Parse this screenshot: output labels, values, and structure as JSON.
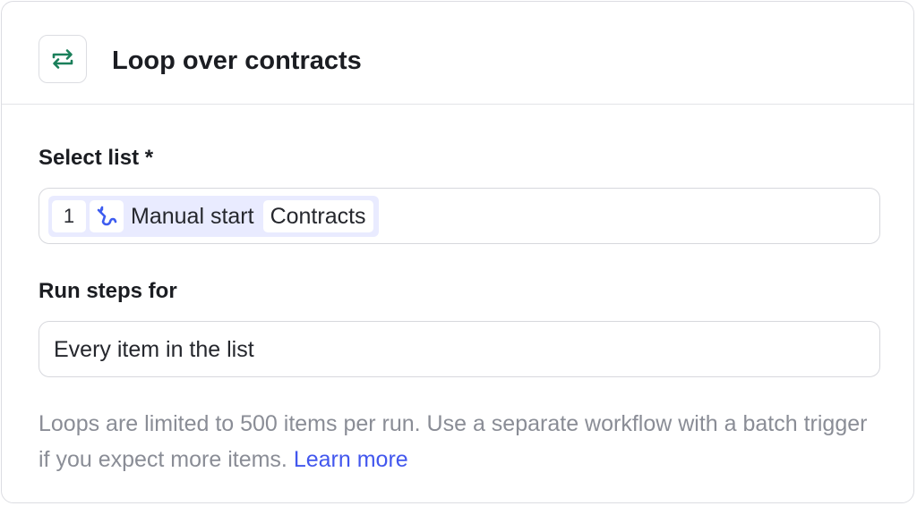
{
  "header": {
    "icon": "loop-arrows-icon",
    "title": "Loop over contracts"
  },
  "select_list": {
    "label": "Select list *",
    "chip": {
      "step_number": "1",
      "step_icon": "manual-trigger-icon",
      "step_name": "Manual start",
      "field_name": "Contracts"
    }
  },
  "run_steps": {
    "label": "Run steps for",
    "value": "Every item in the list"
  },
  "help": {
    "text": "Loops are limited to 500 items per run. Use a separate workflow with a batch trigger if you expect more items.",
    "link_label": "Learn more"
  },
  "colors": {
    "accent_green": "#1a7f5a",
    "link_blue": "#4257ee",
    "chip_bg": "#e9ebff"
  }
}
